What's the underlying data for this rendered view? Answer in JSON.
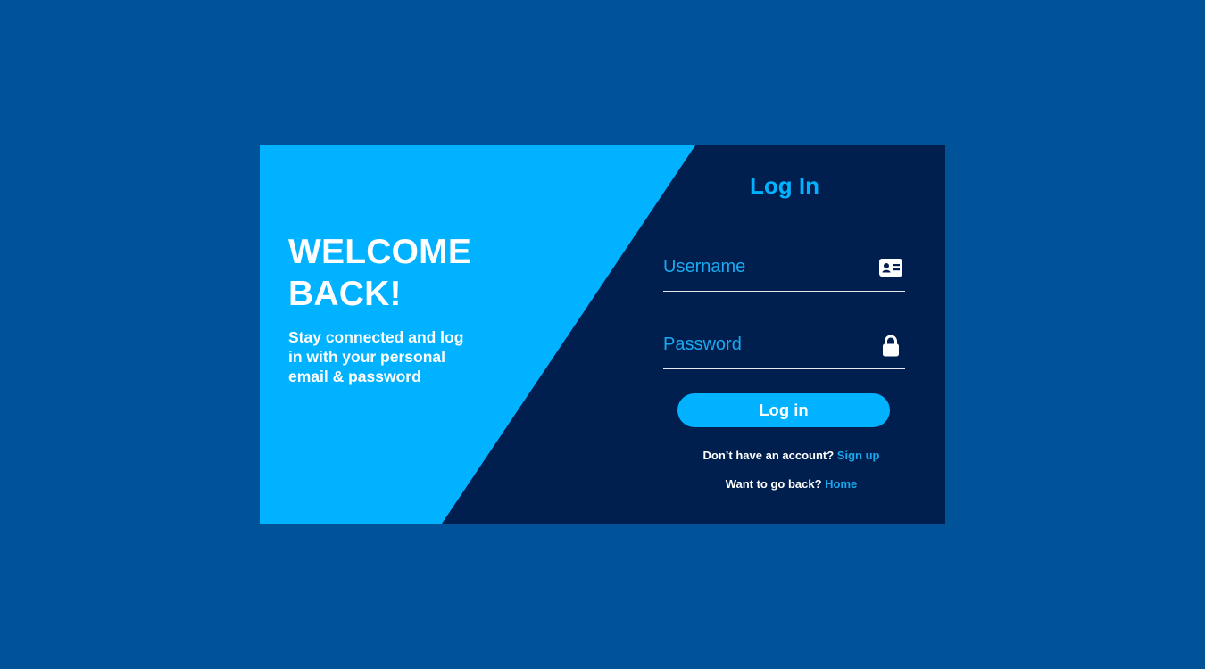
{
  "colors": {
    "page_background": "#005398",
    "panel_light": "#00b2ff",
    "panel_dark": "#001f4f",
    "accent": "#00b2ff",
    "text": "#ffffff"
  },
  "welcome": {
    "title_line1": "WELCOME",
    "title_line2": "BACK!",
    "subtitle": "Stay connected and log in with your personal email & password"
  },
  "login": {
    "title": "Log In",
    "username": {
      "placeholder": "Username",
      "value": "",
      "icon": "id-card-icon"
    },
    "password": {
      "placeholder": "Password",
      "value": "",
      "icon": "lock-icon"
    },
    "submit_label": "Log in",
    "signup_prompt": "Don’t have an account?",
    "signup_link": "Sign up",
    "home_prompt": "Want to go back?",
    "home_link": "Home"
  }
}
